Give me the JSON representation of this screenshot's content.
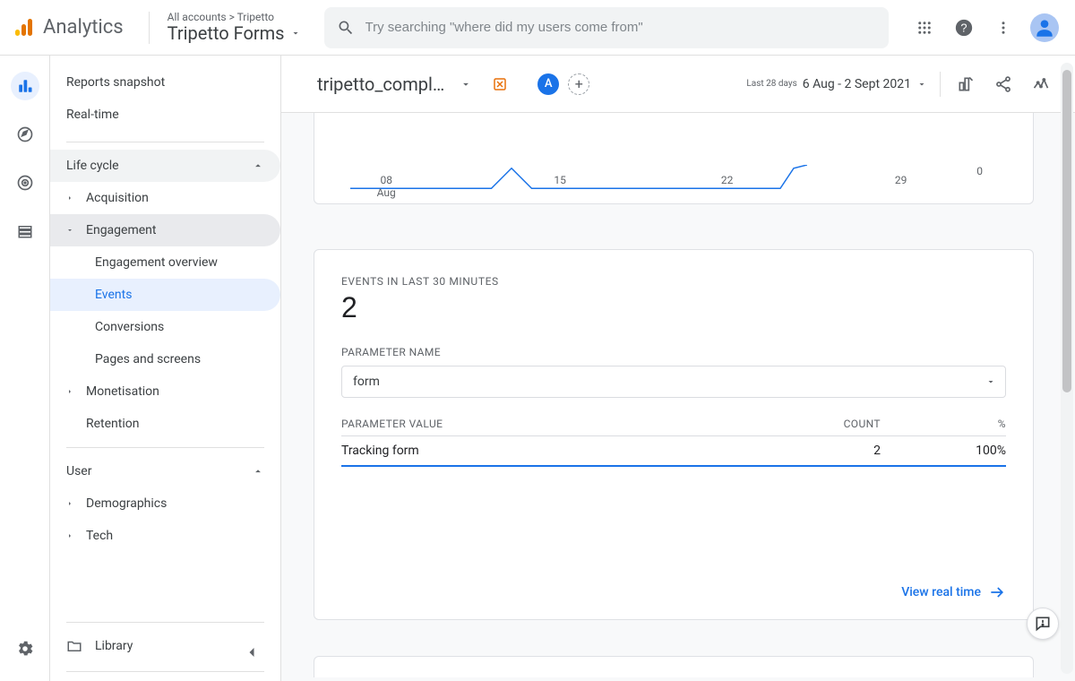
{
  "header": {
    "product": "Analytics",
    "breadcrumb_top": "All accounts > Tripetto",
    "breadcrumb_main": "Tripetto Forms",
    "search_placeholder": "Try searching \"where did my users come from\""
  },
  "rail": {
    "items": [
      "reports-icon",
      "explore-icon",
      "advertising-icon",
      "configure-icon"
    ],
    "settings": "settings-icon"
  },
  "nav": {
    "items": [
      {
        "label": "Reports snapshot"
      },
      {
        "label": "Real-time"
      }
    ],
    "section1": {
      "label": "Life cycle"
    },
    "subs1": [
      {
        "label": "Acquisition"
      },
      {
        "label": "Engagement",
        "children": [
          {
            "label": "Engagement overview"
          },
          {
            "label": "Events"
          },
          {
            "label": "Conversions"
          },
          {
            "label": "Pages and screens"
          }
        ]
      },
      {
        "label": "Monetisation"
      },
      {
        "label": "Retention"
      }
    ],
    "section2": {
      "label": "User"
    },
    "subs2": [
      {
        "label": "Demographics"
      },
      {
        "label": "Tech"
      }
    ],
    "library": "Library"
  },
  "mainbar": {
    "event": "tripetto_compl…",
    "compare_chip": "A",
    "date_label": "Last 28 days",
    "date_range": "6 Aug - 2 Sept 2021"
  },
  "chart_data": {
    "type": "line",
    "title": "",
    "xlabel": "",
    "ylabel": "",
    "x_ticks": [
      "08",
      "15",
      "22",
      "29"
    ],
    "x_sublabel": "Aug",
    "y_tick": "0",
    "series": [
      {
        "name": "tripetto_compl…",
        "x": [
          "08",
          "15",
          "22",
          "29"
        ],
        "values": [
          0,
          1,
          0,
          0
        ]
      }
    ],
    "ylim": [
      0,
      1
    ]
  },
  "events_card": {
    "title": "EVENTS IN LAST 30 MINUTES",
    "count": "2",
    "param_label": "PARAMETER NAME",
    "param_value": "form",
    "table": {
      "headers": {
        "c1": "PARAMETER VALUE",
        "c2": "COUNT",
        "c3": "%"
      },
      "rows": [
        {
          "c1": "Tracking form",
          "c2": "2",
          "c3": "100%"
        }
      ]
    },
    "view_realtime": "View real time"
  }
}
